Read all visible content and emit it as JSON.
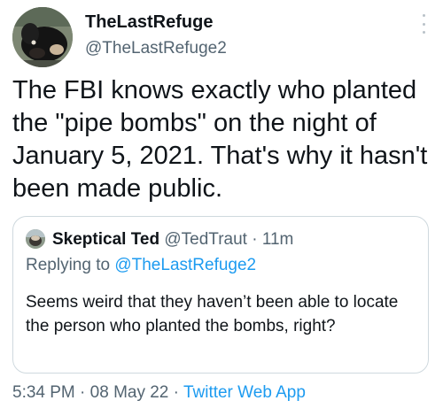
{
  "author": {
    "name": "TheLastRefuge",
    "handle": "@TheLastRefuge2"
  },
  "tweet": {
    "text": "The FBI knows exactly who planted the \"pipe bombs\" on the night of January 5, 2021.  That's why it hasn't been made public."
  },
  "quote": {
    "name": "Skeptical Ted",
    "handle": "@TedTraut",
    "separator": " · ",
    "time": "11m",
    "replying_prefix": "Replying to ",
    "replying_to": "@TheLastRefuge2",
    "text": "Seems weird that they haven’t been able to locate the person who planted the bombs, right?"
  },
  "footer": {
    "time": "5:34 PM",
    "separator": " · ",
    "date": "08 May 22",
    "app": "Twitter Web App"
  },
  "colors": {
    "link": "#1d9bf0",
    "secondary_text": "#536471",
    "border": "#cfd9de"
  },
  "icons": {
    "more": "more-options-icon"
  }
}
